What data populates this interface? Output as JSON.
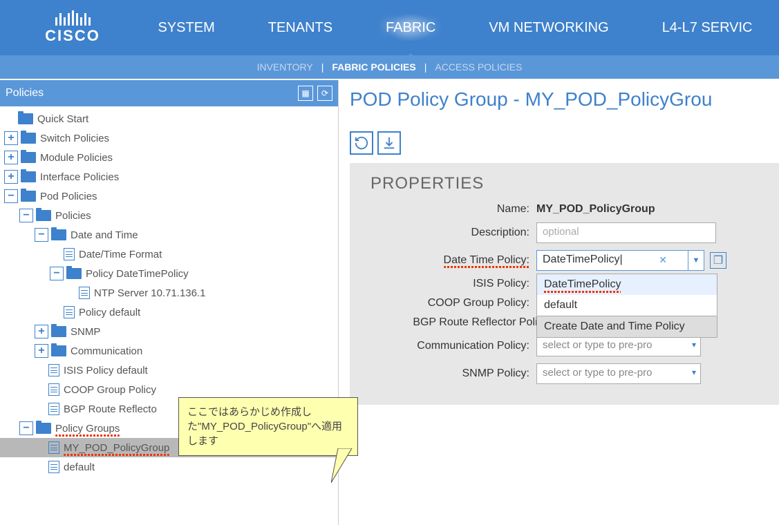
{
  "logo_text": "CISCO",
  "nav": {
    "system": "SYSTEM",
    "tenants": "TENANTS",
    "fabric": "FABRIC",
    "vm": "VM NETWORKING",
    "l4l7": "L4-L7 SERVIC"
  },
  "subnav": {
    "inventory": "INVENTORY",
    "fabric_policies": "FABRIC POLICIES",
    "access_policies": "ACCESS POLICIES"
  },
  "left_header": "Policies",
  "tree": {
    "quick_start": "Quick Start",
    "switch_policies": "Switch Policies",
    "module_policies": "Module Policies",
    "interface_policies": "Interface Policies",
    "pod_policies": "Pod Policies",
    "policies": "Policies",
    "date_and_time": "Date and Time",
    "date_time_format": "Date/Time Format",
    "policy_datetimepolicy": "Policy DateTimePolicy",
    "ntp_server": "NTP Server 10.71.136.1",
    "policy_default": "Policy default",
    "snmp": "SNMP",
    "communication": "Communication",
    "isis_policy_default": "ISIS Policy default",
    "coop_group_policy": "COOP Group Policy",
    "bgp_route_reflector": "BGP Route Reflecto",
    "policy_groups": "Policy Groups",
    "my_pod_policygroup": "MY_POD_PolicyGroup",
    "default": "default"
  },
  "page_title": "POD Policy Group - MY_POD_PolicyGrou",
  "props_title": "PROPERTIES",
  "props": {
    "name_label": "Name:",
    "name_val": "MY_POD_PolicyGroup",
    "desc_label": "Description:",
    "desc_placeholder": "optional",
    "dt_label": "Date Time Policy:",
    "dt_val": "DateTimePolicy",
    "isis_label": "ISIS Policy:",
    "coop_label": "COOP Group Policy:",
    "bgp_label": "BGP Route Reflector Policy:",
    "comm_label": "Communication Policy:",
    "comm_placeholder": "select or type to pre-pro",
    "snmp_label": "SNMP Policy:",
    "snmp_placeholder": "select or type to pre-pro"
  },
  "dropdown": {
    "opt1": "DateTimePolicy",
    "opt2": "default",
    "create": "Create Date and Time Policy"
  },
  "callout": "ここではあらかじめ作成した\"MY_POD_PolicyGroup\"へ適用します"
}
